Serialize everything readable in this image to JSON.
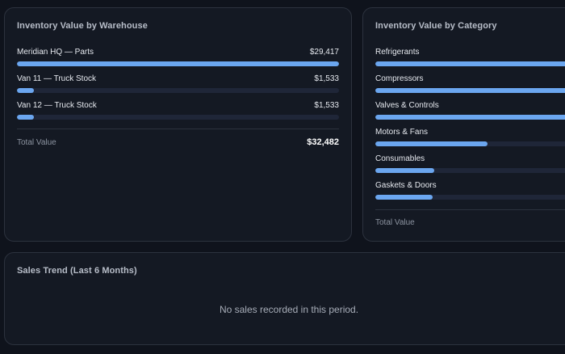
{
  "warehouse_card": {
    "title": "Inventory Value by Warehouse",
    "rows": [
      {
        "label": "Meridian HQ — Parts",
        "value": "$29,417",
        "fill_fraction": 1.0
      },
      {
        "label": "Van 11 — Truck Stock",
        "value": "$1,533",
        "fill_fraction": 0.052
      },
      {
        "label": "Van 12 — Truck Stock",
        "value": "$1,533",
        "fill_fraction": 0.052
      }
    ],
    "total_label": "Total Value",
    "total_value": "$32,482"
  },
  "category_card": {
    "title": "Inventory Value by Category",
    "rows": [
      {
        "label": "Refrigerants",
        "fill_fraction": 1.0
      },
      {
        "label": "Compressors",
        "fill_fraction": 1.0
      },
      {
        "label": "Valves & Controls",
        "fill_fraction": 1.0
      },
      {
        "label": "Motors & Fans",
        "fill_fraction": 0.55
      },
      {
        "label": "Consumables",
        "fill_fraction": 0.29
      },
      {
        "label": "Gaskets & Doors",
        "fill_fraction": 0.28
      }
    ],
    "total_label": "Total Value"
  },
  "sales_card": {
    "title": "Sales Trend (Last 6 Months)",
    "empty_message": "No sales recorded in this period."
  },
  "colors": {
    "bar_fill": "#6ba6ef",
    "bar_track": "#1f2638",
    "card_background": "#141923",
    "page_background": "#0f131c"
  }
}
